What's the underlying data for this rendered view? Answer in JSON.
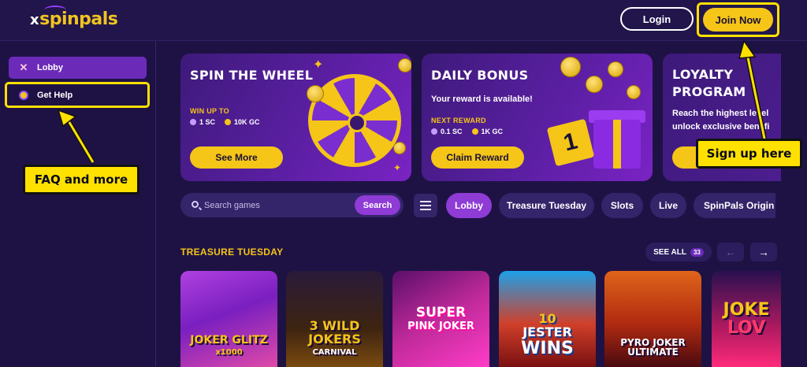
{
  "header": {
    "logo_prefix": "x",
    "logo_text": "spinpals",
    "login_label": "Login",
    "join_label": "Join Now"
  },
  "sidebar": {
    "items": [
      {
        "label": "Lobby",
        "icon": "x-icon"
      },
      {
        "label": "Get Help",
        "icon": "help-icon"
      }
    ]
  },
  "callouts": {
    "faq": "FAQ and more",
    "signup": "Sign up here"
  },
  "banners": [
    {
      "title": "SPIN THE WHEEL",
      "label": "WIN UP TO",
      "reward_sc": "1 SC",
      "reward_gc": "10K GC",
      "button": "See More"
    },
    {
      "title": "DAILY BONUS",
      "subtitle": "Your reward is available!",
      "label": "NEXT REWARD",
      "reward_sc": "0.1 SC",
      "reward_gc": "1K GC",
      "button": "Claim Reward",
      "calendar_day": "1"
    },
    {
      "title_line1": "LOYALTY",
      "title_line2": "PROGRAM",
      "text_line1": "Reach the highest level",
      "text_line2": "unlock exclusive benefi"
    }
  ],
  "search": {
    "placeholder": "Search games",
    "button": "Search"
  },
  "categories": [
    "Lobby",
    "Treasure Tuesday",
    "Slots",
    "Live",
    "SpinPals Origin"
  ],
  "section": {
    "title": "TREASURE TUESDAY",
    "see_all": "SEE ALL",
    "count": "33"
  },
  "games": [
    {
      "line1": "JOKER GLITZ",
      "line2": "x1000"
    },
    {
      "line1": "3 WILD",
      "line2": "JOKERS",
      "line3": "CARNIVAL"
    },
    {
      "line1": "SUPER",
      "line2": "PINK JOKER"
    },
    {
      "line1": "10",
      "line2": "JESTER",
      "line3": "WINS"
    },
    {
      "line1": "PYRO JOKER",
      "line2": "ULTIMATE"
    },
    {
      "line1": "JOKE",
      "line2": "LOV"
    }
  ],
  "colors": {
    "background": "#1e1245",
    "accent_yellow": "#f5c518",
    "accent_purple": "#8f3bd6",
    "callout_yellow": "#ffe100"
  }
}
